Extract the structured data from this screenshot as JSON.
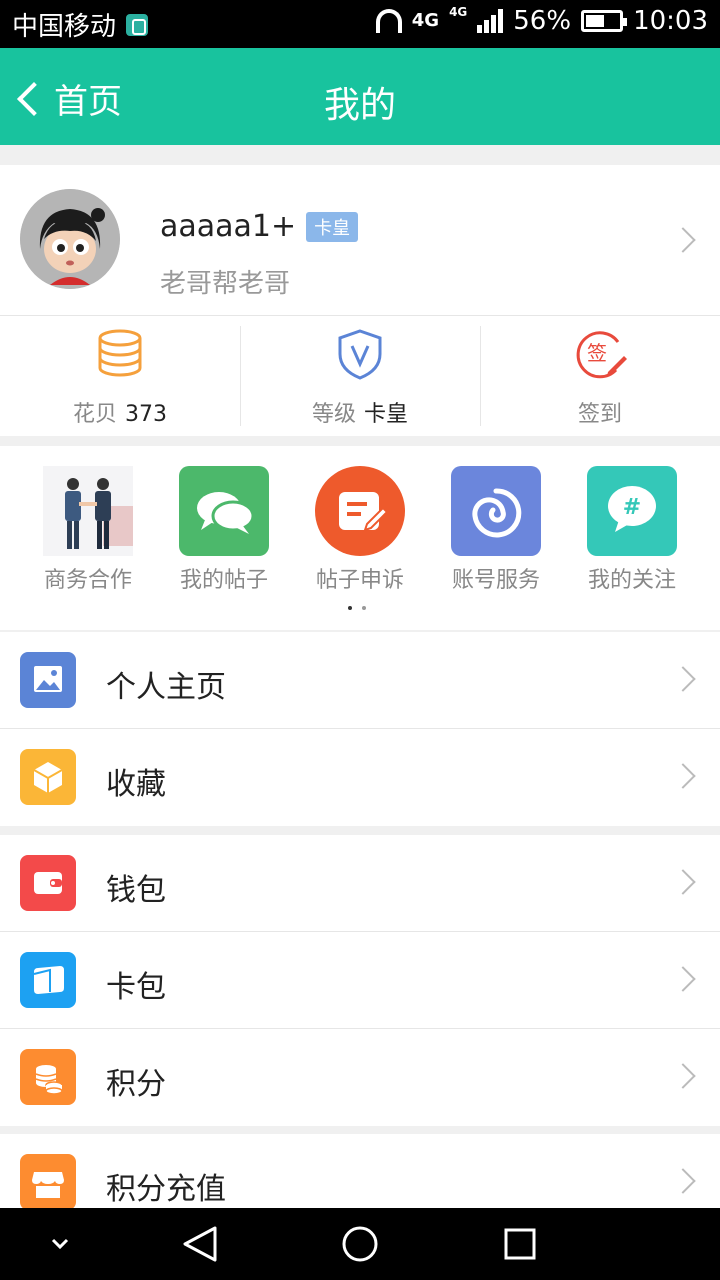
{
  "status_bar": {
    "carrier": "中国移动",
    "network": "4G",
    "network_small": "4G",
    "battery": "56%",
    "time": "10:03"
  },
  "title_bar": {
    "back_label": "首页",
    "title": "我的"
  },
  "profile": {
    "username": "aaaaa1+",
    "badge": "卡皇",
    "subtitle": "老哥帮老哥"
  },
  "stats": [
    {
      "label": "花贝",
      "value": "373",
      "icon": "coins-stack-icon",
      "color": "#f5a03c"
    },
    {
      "label": "等级",
      "value": "卡皇",
      "icon": "shield-v-icon",
      "color": "#5b84d6"
    },
    {
      "label": "签到",
      "value": "",
      "icon": "sign-in-icon",
      "color": "#e84a3c"
    }
  ],
  "grid": [
    {
      "label": "商务合作",
      "icon": "business-people-icon"
    },
    {
      "label": "我的帖子",
      "icon": "chat-bubbles-icon",
      "color": "#4cb86b"
    },
    {
      "label": "帖子申诉",
      "icon": "edit-note-icon",
      "color": "#ee5a2c"
    },
    {
      "label": "账号服务",
      "icon": "spiral-icon",
      "color": "#6b86dc"
    },
    {
      "label": "我的关注",
      "icon": "hashtag-bubble-icon",
      "color": "#34c8b8"
    }
  ],
  "menu": {
    "homepage": {
      "label": "个人主页",
      "icon": "picture-icon",
      "color": "#5b84d6"
    },
    "favorites": {
      "label": "收藏",
      "icon": "box-icon",
      "color": "#fbb637"
    },
    "wallet": {
      "label": "钱包",
      "icon": "wallet-icon",
      "color": "#f34a4a"
    },
    "cards": {
      "label": "卡包",
      "icon": "card-icon",
      "color": "#1da1f2"
    },
    "points": {
      "label": "积分",
      "icon": "coins-icon",
      "color": "#fd8c30"
    },
    "recharge": {
      "label": "积分充值",
      "icon": "store-icon",
      "color": "#fd8c30"
    }
  }
}
